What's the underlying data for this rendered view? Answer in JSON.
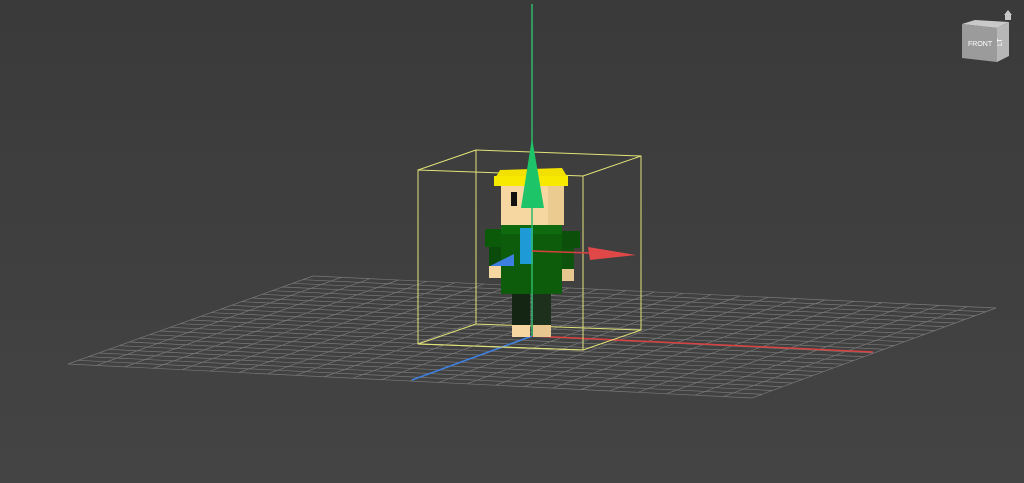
{
  "viewport": {
    "grid_color": "#7a7a7a",
    "axis_x_color": "#d94040",
    "axis_y_color": "#2fb86a",
    "axis_z_color": "#3d7fe0",
    "bbox_color": "#e3e37a"
  },
  "viewcube": {
    "front_label": "FRONT",
    "side_label": "LT",
    "home_icon": "home-icon"
  },
  "character": {
    "hat_color": "#f2e100",
    "skin_color": "#f6d7a2",
    "shirt_color": "#0c5c0c",
    "tie_color": "#1e9ad6",
    "pants_color": "#142514"
  }
}
